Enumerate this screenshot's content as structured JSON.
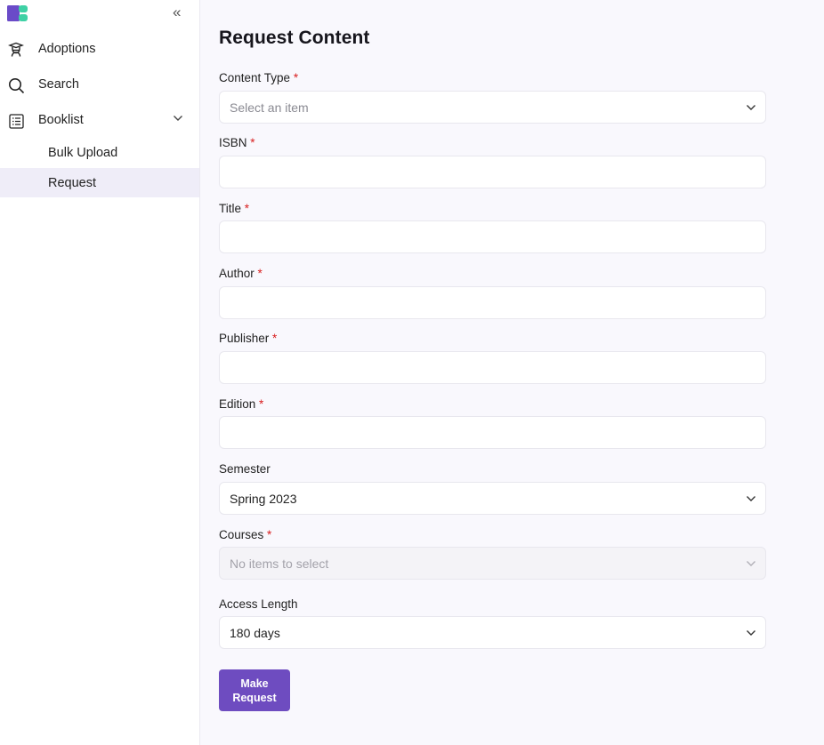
{
  "sidebar": {
    "brand_colors": {
      "primary": "#6a4bc8",
      "accent": "#3fd1a5"
    },
    "collapse_icon": "double-chevron-left-icon",
    "collapse_glyph": "«",
    "items": [
      {
        "label": "Adoptions",
        "icon": "graduate-icon"
      },
      {
        "label": "Search",
        "icon": "search-icon"
      },
      {
        "label": "Booklist",
        "icon": "list-icon",
        "expanded": true
      }
    ],
    "sub_items": [
      {
        "label": "Bulk Upload",
        "active": false
      },
      {
        "label": "Request",
        "active": true
      }
    ]
  },
  "main": {
    "title": "Request Content",
    "required_marker": "*",
    "fields": {
      "content_type": {
        "label": "Content Type",
        "required": true,
        "placeholder": "Select an item"
      },
      "isbn": {
        "label": "ISBN",
        "required": true,
        "value": ""
      },
      "title": {
        "label": "Title",
        "required": true,
        "value": ""
      },
      "author": {
        "label": "Author",
        "required": true,
        "value": ""
      },
      "publisher": {
        "label": "Publisher",
        "required": true,
        "value": ""
      },
      "edition": {
        "label": "Edition",
        "required": true,
        "value": ""
      },
      "semester": {
        "label": "Semester",
        "required": false,
        "value": "Spring 2023"
      },
      "courses": {
        "label": "Courses",
        "required": true,
        "placeholder": "No items to select",
        "disabled": true
      },
      "access_length": {
        "label": "Access Length",
        "required": false,
        "value": "180 days"
      }
    },
    "submit_label_line1": "Make",
    "submit_label_line2": "Request",
    "submit_color": "#6e4cc0"
  }
}
